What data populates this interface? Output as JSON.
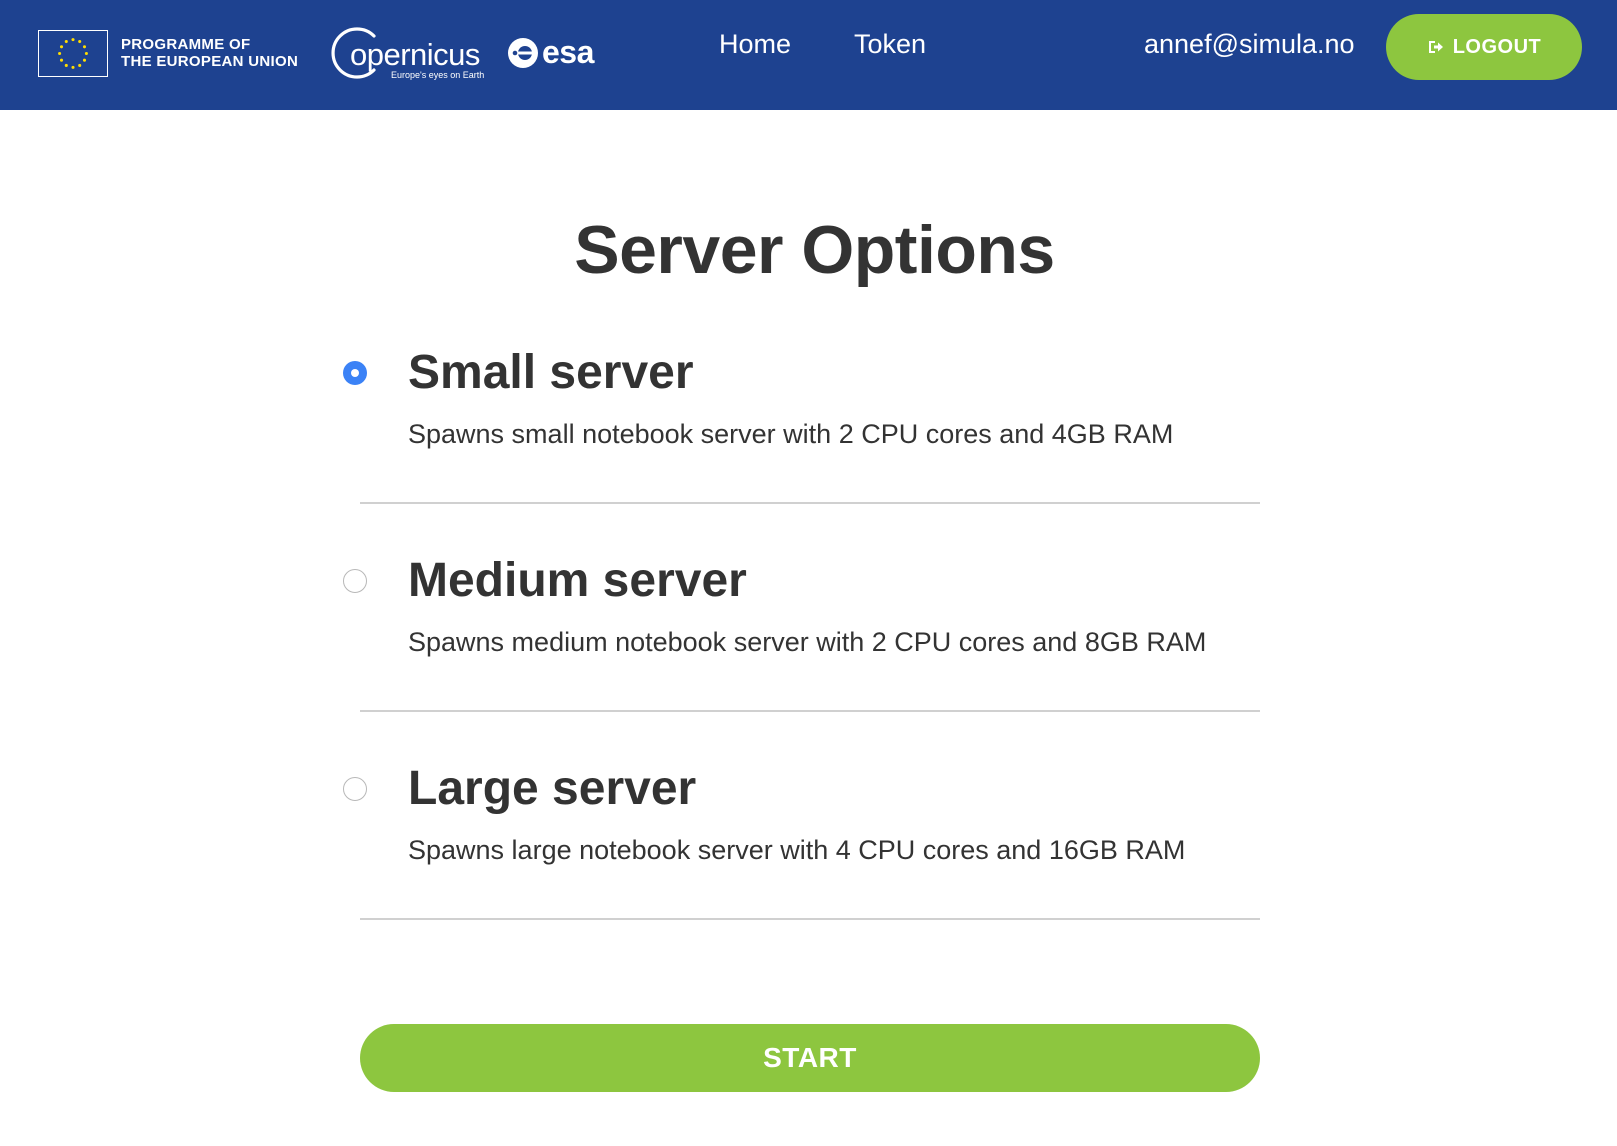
{
  "header": {
    "eu_programme_line1": "PROGRAMME OF",
    "eu_programme_line2": "THE EUROPEAN UNION",
    "copernicus_wordmark": "opernicus",
    "copernicus_tagline": "Europe's eyes on Earth",
    "esa_wordmark": "esa",
    "nav": {
      "home_label": "Home",
      "token_label": "Token"
    },
    "user_email": "annef@simula.no",
    "logout_label": "LOGOUT",
    "logout_icon": "sign-out-icon"
  },
  "main": {
    "title": "Server Options",
    "options": [
      {
        "title": "Small server",
        "description": "Spawns small notebook server with 2 CPU cores and 4GB RAM",
        "selected": true
      },
      {
        "title": "Medium server",
        "description": "Spawns medium notebook server with 2 CPU cores and 8GB RAM",
        "selected": false
      },
      {
        "title": "Large server",
        "description": "Spawns large notebook server with 4 CPU cores and 16GB RAM",
        "selected": false
      }
    ],
    "start_label": "START"
  },
  "colors": {
    "header_bg": "#1e4290",
    "accent_green": "#8dc63f",
    "radio_selected": "#3b82f6",
    "text": "#333333",
    "divider": "#d0d0d0"
  }
}
